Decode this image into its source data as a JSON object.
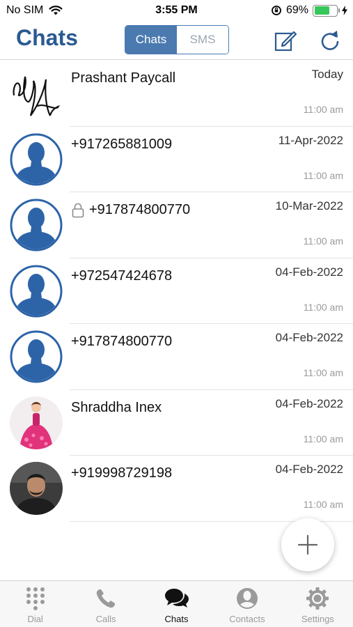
{
  "status_bar": {
    "carrier": "No SIM",
    "time": "3:55 PM",
    "battery_percent": "69%",
    "battery_level": 0.69
  },
  "header": {
    "title": "Chats",
    "segments": [
      "Chats",
      "SMS"
    ],
    "active_segment": "Chats"
  },
  "chats": [
    {
      "name": "Prashant Paycall",
      "date": "Today",
      "time": "11:00 am",
      "avatar": "signature-image",
      "locked": false
    },
    {
      "name": "+917265881009",
      "date": "11-Apr-2022",
      "time": "11:00 am",
      "avatar": "default-user-icon",
      "locked": false
    },
    {
      "name": "+917874800770",
      "date": "10-Mar-2022",
      "time": "11:00 am",
      "avatar": "default-user-icon",
      "locked": true
    },
    {
      "name": "+972547424678",
      "date": "04-Feb-2022",
      "time": "11:00 am",
      "avatar": "default-user-icon",
      "locked": false
    },
    {
      "name": "+917874800770",
      "date": "04-Feb-2022",
      "time": "11:00 am",
      "avatar": "default-user-icon",
      "locked": false
    },
    {
      "name": "Shraddha Inex",
      "date": "04-Feb-2022",
      "time": "11:00 am",
      "avatar": "doll-photo",
      "locked": false
    },
    {
      "name": "+919998729198",
      "date": "04-Feb-2022",
      "time": "11:00 am",
      "avatar": "person-photo",
      "locked": false
    }
  ],
  "tabs": [
    {
      "label": "Dial",
      "icon": "dialpad-icon",
      "active": false
    },
    {
      "label": "Calls",
      "icon": "phone-icon",
      "active": false
    },
    {
      "label": "Chats",
      "icon": "chat-bubbles-icon",
      "active": true
    },
    {
      "label": "Contacts",
      "icon": "contact-icon",
      "active": false
    },
    {
      "label": "Settings",
      "icon": "gear-icon",
      "active": false
    }
  ],
  "colors": {
    "accent": "#2b5a91",
    "segment": "#4a7ab0",
    "avatar_blue": "#2d64a8",
    "battery": "#35c759"
  }
}
